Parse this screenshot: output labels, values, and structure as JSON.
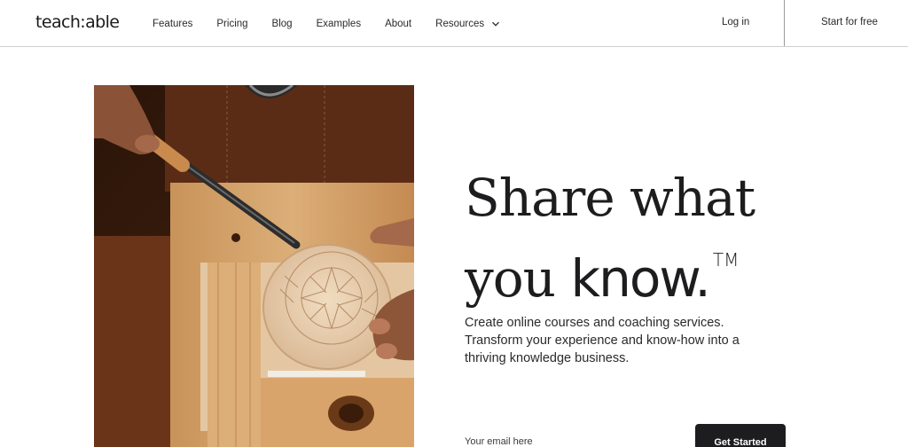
{
  "header": {
    "logo": "teach:able",
    "nav": [
      {
        "label": "Features"
      },
      {
        "label": "Pricing"
      },
      {
        "label": "Blog"
      },
      {
        "label": "Examples"
      },
      {
        "label": "About"
      },
      {
        "label": "Resources",
        "icon": "chevron-down-icon"
      }
    ],
    "login_label": "Log in",
    "start_label": "Start for free"
  },
  "hero": {
    "headline_line1": "Share what",
    "headline_you": "you ",
    "headline_know": "know.",
    "headline_tm": "TM",
    "subtext": "Create online courses and coaching services. Transform your experience and know-how into a thriving knowledge business.",
    "email_placeholder": "Your email here",
    "cta_label": "Get Started",
    "image_icon": "wood-carving-photo"
  },
  "colors": {
    "text": "#1d1d1f",
    "cta_bg": "#1d1d1f",
    "cta_text": "#ffffff",
    "divider": "#cfcfcf"
  }
}
